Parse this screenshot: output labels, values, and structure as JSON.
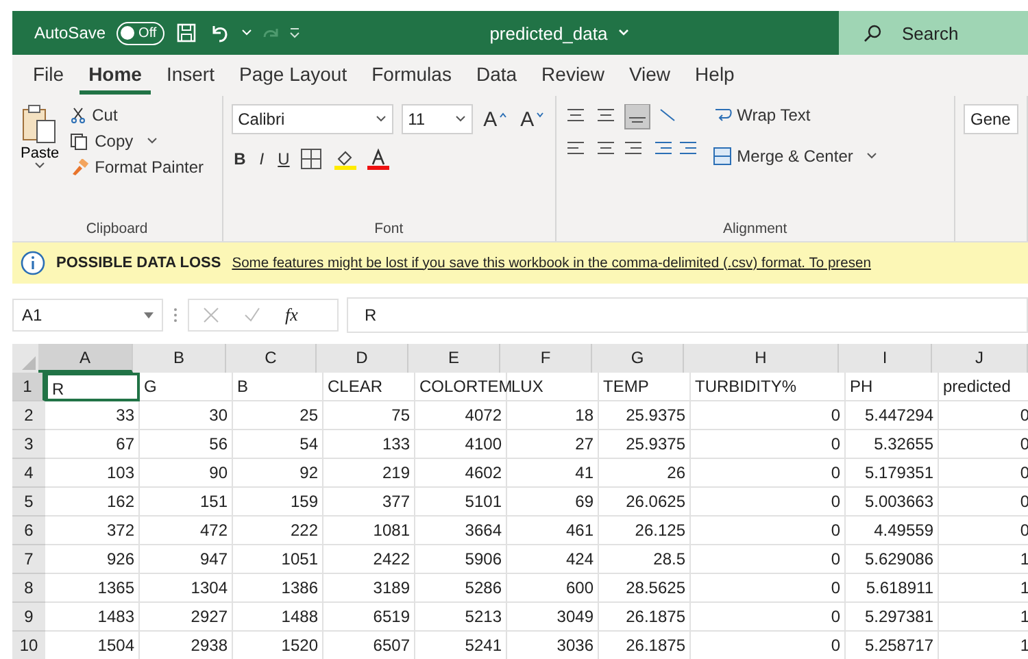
{
  "title_bar": {
    "autosave_label": "AutoSave",
    "autosave": {
      "label": "Off",
      "on": false
    },
    "file_name": "predicted_data",
    "search": {
      "placeholder": "Search"
    }
  },
  "menu_tabs": [
    {
      "label": "File",
      "selected": false
    },
    {
      "label": "Home",
      "selected": true
    },
    {
      "label": "Insert",
      "selected": false
    },
    {
      "label": "Page Layout",
      "selected": false
    },
    {
      "label": "Formulas",
      "selected": false
    },
    {
      "label": "Data",
      "selected": false
    },
    {
      "label": "Review",
      "selected": false
    },
    {
      "label": "View",
      "selected": false
    },
    {
      "label": "Help",
      "selected": false
    }
  ],
  "ribbon": {
    "clipboard": {
      "paste": "Paste",
      "cut": "Cut",
      "copy": "Copy",
      "format_painter": "Format Painter",
      "label": "Clipboard"
    },
    "font": {
      "font_name": "Calibri",
      "font_size": "11",
      "grow": "A",
      "shrink": "A",
      "bold": "B",
      "italic": "I",
      "underline": "U",
      "label": "Font"
    },
    "alignment": {
      "wrap_text": "Wrap Text",
      "merge_center": "Merge & Center",
      "label": "Alignment"
    },
    "number": {
      "format": "Gene"
    }
  },
  "info_bar": {
    "title": "POSSIBLE DATA LOSS",
    "message": "Some features might be lost if you save this workbook in the comma-delimited (.csv) format. To presen"
  },
  "formula_bar": {
    "name_box": "A1",
    "fx": "fx",
    "value": "R"
  },
  "sheet": {
    "columns": [
      {
        "label": "A",
        "selected": true
      },
      {
        "label": "B",
        "selected": false
      },
      {
        "label": "C",
        "selected": false
      },
      {
        "label": "D",
        "selected": false
      },
      {
        "label": "E",
        "selected": false
      },
      {
        "label": "F",
        "selected": false
      },
      {
        "label": "G",
        "selected": false
      },
      {
        "label": "H",
        "selected": false
      },
      {
        "label": "I",
        "selected": false
      },
      {
        "label": "J",
        "selected": false
      }
    ],
    "rows": [
      {
        "number": "1",
        "selected": true,
        "kind": "text",
        "cells": [
          "R",
          "G",
          "B",
          "CLEAR",
          "COLORTEM",
          "LUX",
          "TEMP",
          "TURBIDITY%",
          "PH",
          "predicted"
        ]
      },
      {
        "number": "2",
        "selected": false,
        "kind": "number",
        "cells": [
          "33",
          "30",
          "25",
          "75",
          "4072",
          "18",
          "25.9375",
          "0",
          "5.447294",
          "0"
        ]
      },
      {
        "number": "3",
        "selected": false,
        "kind": "number",
        "cells": [
          "67",
          "56",
          "54",
          "133",
          "4100",
          "27",
          "25.9375",
          "0",
          "5.32655",
          "0"
        ]
      },
      {
        "number": "4",
        "selected": false,
        "kind": "number",
        "cells": [
          "103",
          "90",
          "92",
          "219",
          "4602",
          "41",
          "26",
          "0",
          "5.179351",
          "0"
        ]
      },
      {
        "number": "5",
        "selected": false,
        "kind": "number",
        "cells": [
          "162",
          "151",
          "159",
          "377",
          "5101",
          "69",
          "26.0625",
          "0",
          "5.003663",
          "0"
        ]
      },
      {
        "number": "6",
        "selected": false,
        "kind": "number",
        "cells": [
          "372",
          "472",
          "222",
          "1081",
          "3664",
          "461",
          "26.125",
          "0",
          "4.49559",
          "0"
        ]
      },
      {
        "number": "7",
        "selected": false,
        "kind": "number",
        "cells": [
          "926",
          "947",
          "1051",
          "2422",
          "5906",
          "424",
          "28.5",
          "0",
          "5.629086",
          "1"
        ]
      },
      {
        "number": "8",
        "selected": false,
        "kind": "number",
        "cells": [
          "1365",
          "1304",
          "1386",
          "3189",
          "5286",
          "600",
          "28.5625",
          "0",
          "5.618911",
          "1"
        ]
      },
      {
        "number": "9",
        "selected": false,
        "kind": "number",
        "cells": [
          "1483",
          "2927",
          "1488",
          "6519",
          "5213",
          "3049",
          "26.1875",
          "0",
          "5.297381",
          "1"
        ]
      },
      {
        "number": "10",
        "selected": false,
        "kind": "number",
        "cells": [
          "1504",
          "2938",
          "1520",
          "6507",
          "5241",
          "3036",
          "26.1875",
          "0",
          "5.258717",
          "1"
        ]
      }
    ]
  }
}
